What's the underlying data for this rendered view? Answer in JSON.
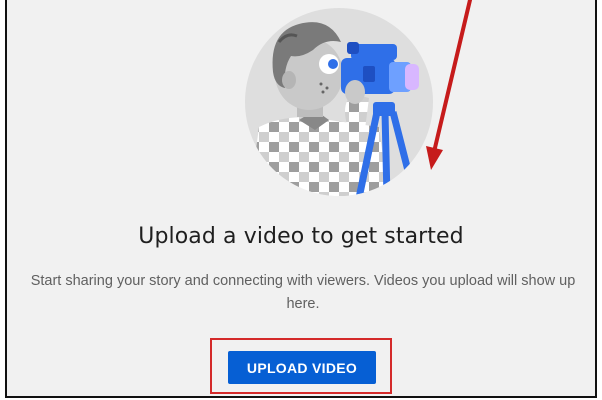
{
  "empty_state": {
    "headline": "Upload a video to get started",
    "subtext": "Start sharing your story and connecting with viewers. Videos you upload will show up here.",
    "upload_button_label": "UPLOAD VIDEO"
  },
  "colors": {
    "button_blue": "#065fd4",
    "annotation_red": "#c61b1b",
    "panel_background": "#f1f1f1"
  },
  "icons": {
    "illustration": "videographer-illustration",
    "annotation": "red-arrow-annotation"
  }
}
